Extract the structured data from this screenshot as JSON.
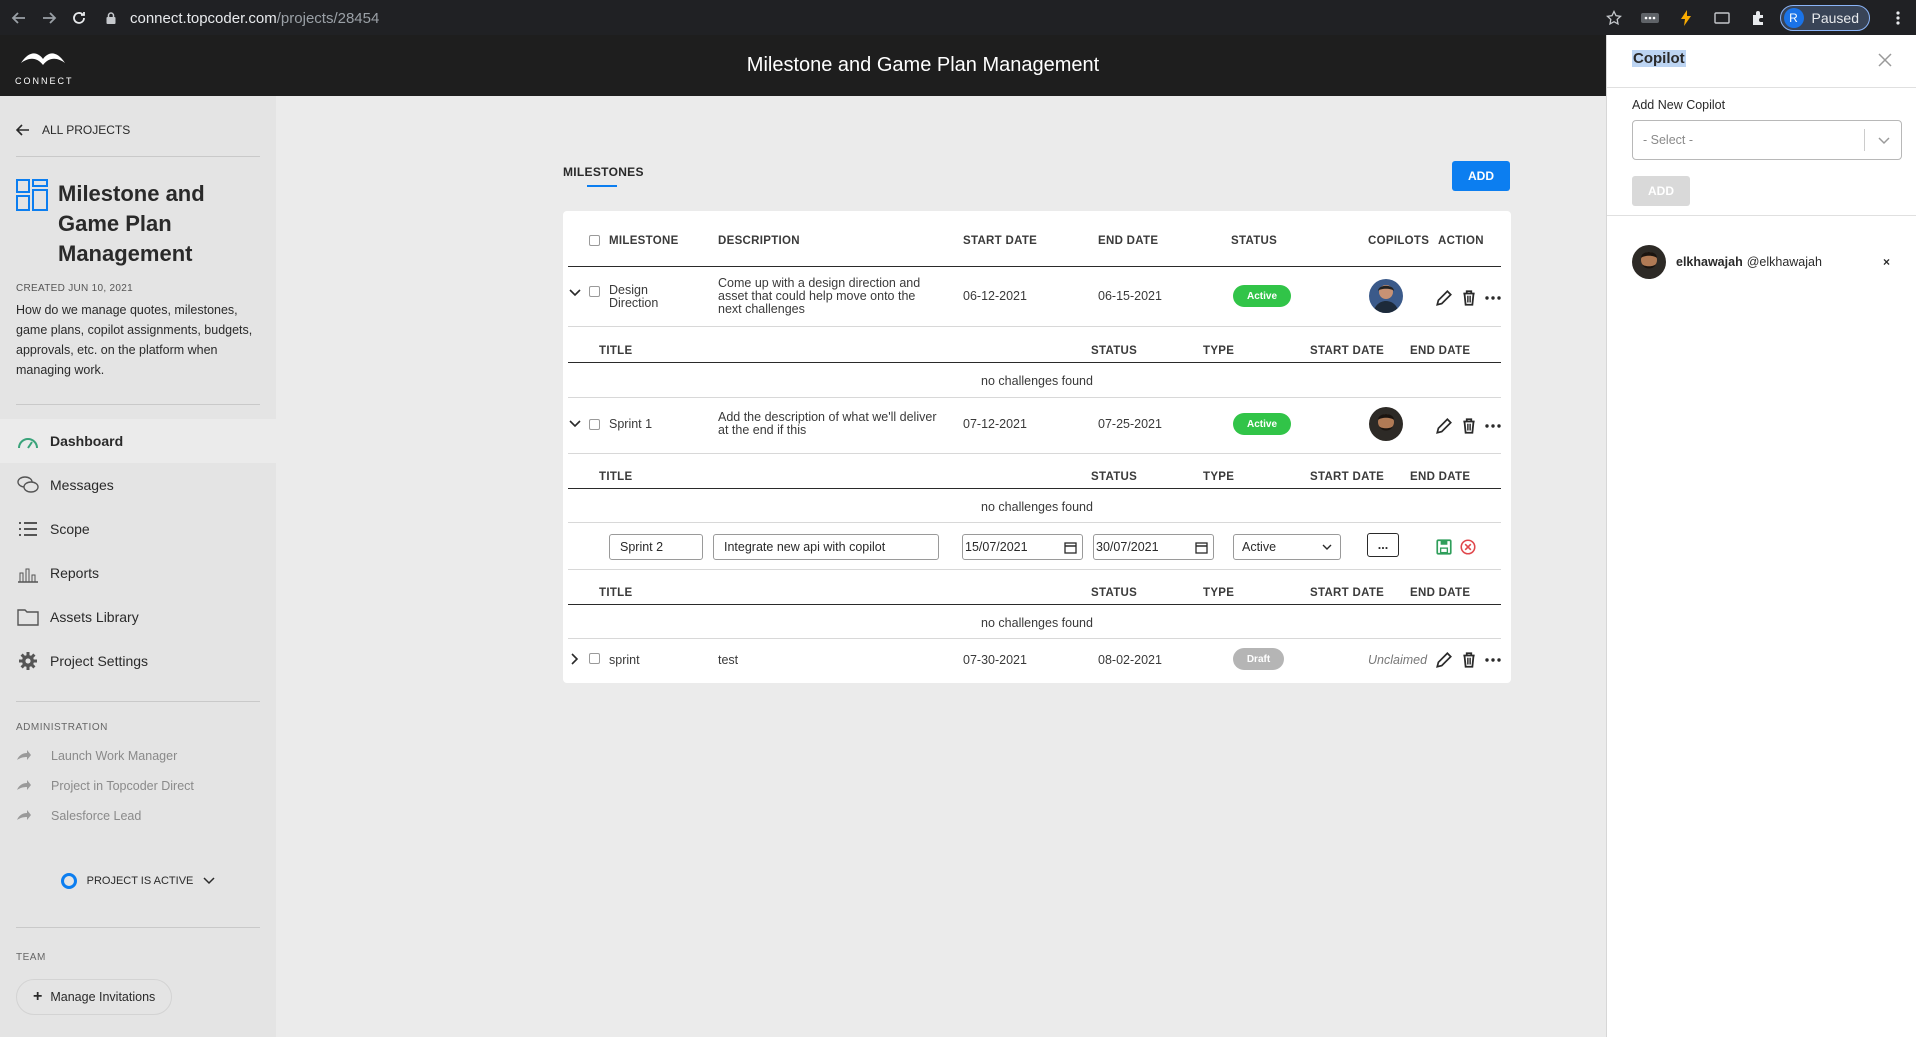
{
  "browser": {
    "url_host": "connect.topcoder.com",
    "url_path": "/projects/28454",
    "profile_initial": "R",
    "profile_status": "Paused"
  },
  "header": {
    "logo_text": "CONNECT",
    "title": "Milestone and Game Plan Management"
  },
  "sidebar": {
    "back_label": "ALL PROJECTS",
    "project_title": "Milestone and Game Plan Management",
    "created": "CREATED JUN 10, 2021",
    "description": "How do we manage quotes, milestones, game plans, copilot assignments, budgets, approvals, etc. on the platform when managing work.",
    "nav": [
      {
        "label": "Dashboard",
        "icon": "dashboard-icon"
      },
      {
        "label": "Messages",
        "icon": "messages-icon"
      },
      {
        "label": "Scope",
        "icon": "scope-icon"
      },
      {
        "label": "Reports",
        "icon": "reports-icon"
      },
      {
        "label": "Assets Library",
        "icon": "folder-icon"
      },
      {
        "label": "Project Settings",
        "icon": "gear-icon"
      }
    ],
    "admin_heading": "ADMINISTRATION",
    "admin_items": [
      "Launch Work Manager",
      "Project in Topcoder Direct",
      "Salesforce Lead"
    ],
    "project_status": "PROJECT IS ACTIVE",
    "team_heading": "TEAM",
    "manage_invitations": "Manage Invitations"
  },
  "milestones": {
    "title": "MILESTONES",
    "add_label": "ADD",
    "columns": [
      "MILESTONE",
      "DESCRIPTION",
      "START DATE",
      "END DATE",
      "STATUS",
      "COPILOTS",
      "ACTION"
    ],
    "sub_columns": [
      "TITLE",
      "STATUS",
      "TYPE",
      "START DATE",
      "END DATE"
    ],
    "empty_text": "no challenges found",
    "rows": [
      {
        "name": "Design Direction",
        "description": "Come up with a design direction and asset that could help move onto the next challenges",
        "start": "06-12-2021",
        "end": "06-15-2021",
        "status": "Active"
      },
      {
        "name": "Sprint 1",
        "description": "Add the description of what we'll deliver at the end if this",
        "start": "07-12-2021",
        "end": "07-25-2021",
        "status": "Active"
      },
      {
        "name": "sprint",
        "description": "test",
        "start": "07-30-2021",
        "end": "08-02-2021",
        "status": "Draft",
        "copilot": "Unclaimed"
      }
    ],
    "edit_row": {
      "name": "Sprint 2",
      "description": "Integrate new api with copilot",
      "start": "15/07/2021",
      "end": "30/07/2021",
      "status": "Active",
      "copilot_button": "..."
    }
  },
  "copilot_panel": {
    "title": "Copilot",
    "add_label": "Add New Copilot",
    "select_placeholder": "- Select -",
    "add_button": "ADD",
    "user_name": "elkhawajah",
    "user_handle": "@elkhawajah",
    "remove": "×"
  },
  "colors": {
    "accent": "#0c7ef0",
    "active": "#31c448",
    "draft": "#b5b5b5",
    "header": "#1e1e1e"
  }
}
